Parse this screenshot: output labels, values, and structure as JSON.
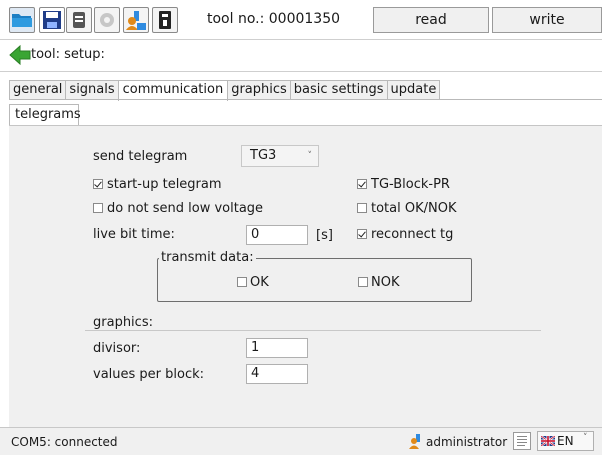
{
  "toolbar": {
    "icons": [
      "folder-open-icon",
      "save-icon",
      "list-icon",
      "gear-icon",
      "user-upload-icon",
      "device-icon"
    ],
    "tool_no": "tool no.: 00001350",
    "read_label": "read",
    "write_label": "write"
  },
  "nav": {
    "back_label": "tool: setup:"
  },
  "tabs": [
    "general",
    "signals",
    "communication",
    "graphics",
    "basic settings",
    "update"
  ],
  "active_tab": "communication",
  "subtabs": [
    "telegrams"
  ],
  "form": {
    "send_telegram_label": "send telegram",
    "send_telegram_value": "TG3",
    "startup_telegram": {
      "label": "start-up telegram",
      "checked": true
    },
    "no_low_voltage": {
      "label": "do not send low voltage",
      "checked": false
    },
    "tg_block_pr": {
      "label": "TG-Block-PR",
      "checked": true
    },
    "total_ok_nok": {
      "label": "total OK/NOK",
      "checked": false
    },
    "reconnect_tg": {
      "label": "reconnect tg",
      "checked": true
    },
    "live_bit_label": "live bit time:",
    "live_bit_value": "0",
    "live_bit_unit": "[s]",
    "transmit_title": "transmit data:",
    "transmit_ok": {
      "label": "OK",
      "checked": false
    },
    "transmit_nok": {
      "label": "NOK",
      "checked": false
    },
    "graphics_title": "graphics:",
    "divisor_label": "divisor:",
    "divisor_value": "1",
    "values_per_block_label": "values per block:",
    "values_per_block_value": "4"
  },
  "status": {
    "connection": "COM5: connected",
    "user": "administrator",
    "language": "EN"
  }
}
